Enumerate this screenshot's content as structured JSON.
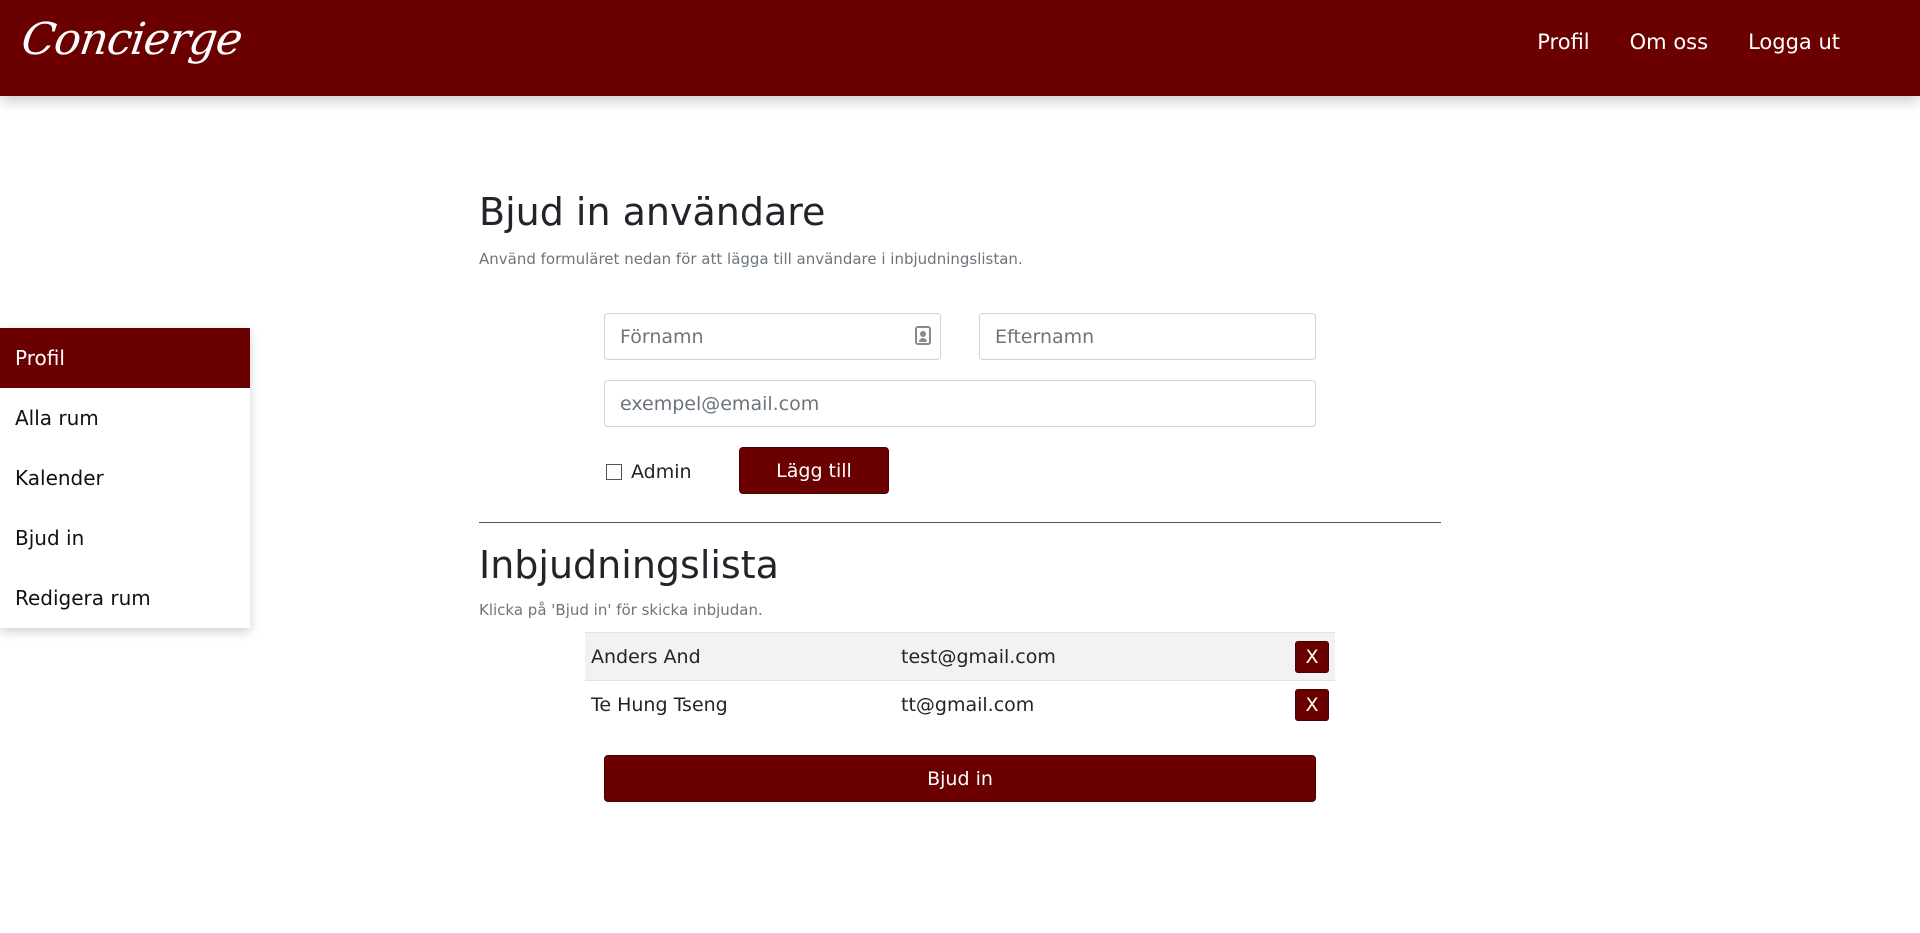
{
  "navbar": {
    "brand": "Concierge",
    "links": [
      "Profil",
      "Om oss",
      "Logga ut"
    ]
  },
  "sidebar": {
    "items": [
      {
        "label": "Profil",
        "active": true
      },
      {
        "label": "Alla rum"
      },
      {
        "label": "Kalender"
      },
      {
        "label": "Bjud in"
      },
      {
        "label": "Redigera rum"
      }
    ]
  },
  "invite_form": {
    "title": "Bjud in användare",
    "hint": "Använd formuläret nedan för att lägga till användare i inbjudningslistan.",
    "first_name_placeholder": "Förnamn",
    "last_name_placeholder": "Efternamn",
    "email_placeholder": "exempel@email.com",
    "admin_label": "Admin",
    "add_button": "Lägg till"
  },
  "invite_list": {
    "title": "Inbjudningslista",
    "hint": "Klicka på 'Bjud in' för skicka inbjudan.",
    "rows": [
      {
        "name": "Anders And",
        "email": "test@gmail.com",
        "remove": "X"
      },
      {
        "name": "Te Hung Tseng",
        "email": "tt@gmail.com",
        "remove": "X"
      }
    ],
    "invite_button": "Bjud in"
  },
  "colors": {
    "brand": "#6b0000"
  }
}
